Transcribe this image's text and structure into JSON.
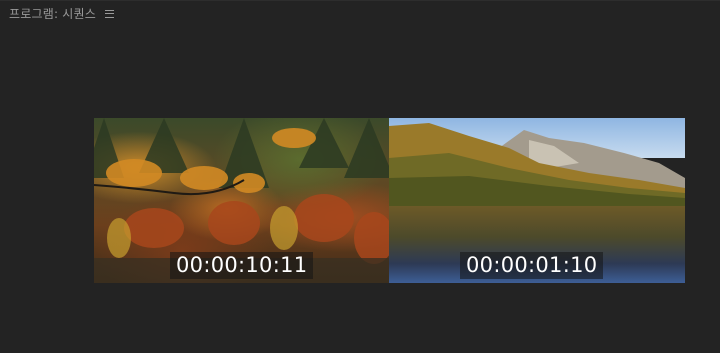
{
  "panel": {
    "title": "프로그램: 시퀀스"
  },
  "icons": {
    "panel_menu": "hamburger-menu-icon"
  },
  "monitor": {
    "left_view": {
      "timecode": "00:00:10:11",
      "content": "autumn-forest-image"
    },
    "right_view": {
      "timecode": "00:00:01:10",
      "content": "mountain-lake-image"
    }
  },
  "colors": {
    "panel_background": "#232323",
    "title_text": "#9a9a9a",
    "timecode_text": "#ffffff"
  }
}
